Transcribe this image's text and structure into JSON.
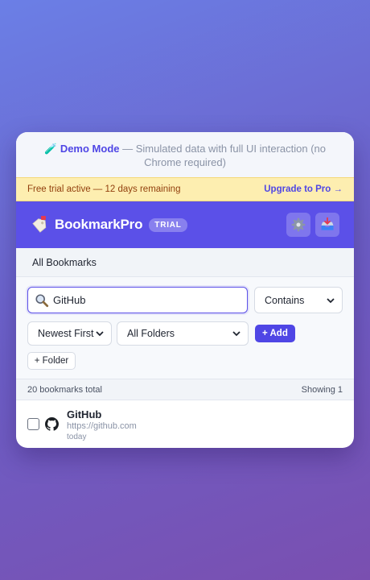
{
  "demo_banner": {
    "icon": "test-tube-icon",
    "title": "Demo Mode",
    "text": " — Simulated data with full UI interaction (no Chrome required)"
  },
  "trial_bar": {
    "text": "Free trial active — 12 days remaining",
    "upgrade_label": "Upgrade to Pro →"
  },
  "header": {
    "brand_icon": "bookmark-tag-icon",
    "brand_name": "BookmarkPro",
    "badge": "TRIAL",
    "actions": [
      {
        "icon": "gear-icon"
      },
      {
        "icon": "inbox-tray-icon"
      }
    ],
    "accent": "#5b50e8"
  },
  "tabs": {
    "active": "All Bookmarks"
  },
  "search": {
    "value": "GitHub",
    "match_mode": "Contains"
  },
  "filters": {
    "sort": "Newest First",
    "folder": "All Folders",
    "add_label": "+ Add",
    "folder_label": "+ Folder"
  },
  "status": {
    "total": "20 bookmarks total",
    "showing": "Showing 1"
  },
  "bookmarks": [
    {
      "icon": "github-icon",
      "title": "GitHub",
      "url": "https://github.com",
      "date": "today",
      "checked": false
    }
  ]
}
